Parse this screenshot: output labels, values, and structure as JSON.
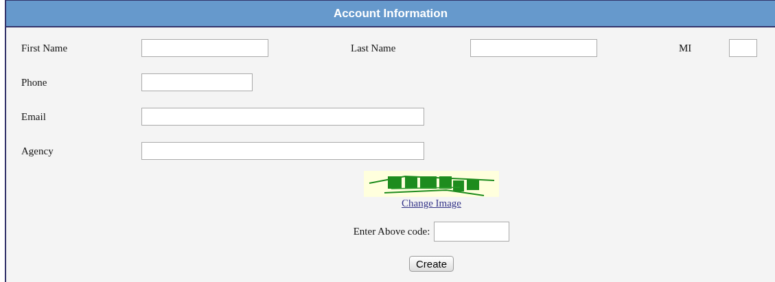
{
  "panel": {
    "title": "Account Information"
  },
  "rows": [
    {
      "fields": [
        {
          "label": "First Name"
        },
        {
          "label": "Last Name"
        },
        {
          "label": "MI"
        }
      ]
    },
    {
      "fields": [
        {
          "label": "Phone"
        }
      ]
    },
    {
      "fields": [
        {
          "label": "Email"
        }
      ]
    },
    {
      "fields": [
        {
          "label": "Agency"
        }
      ]
    }
  ],
  "captcha": {
    "kind": "picture",
    "link": "Change Image",
    "prompt": "Enter Above code:"
  },
  "buttons": [
    "Create"
  ]
}
